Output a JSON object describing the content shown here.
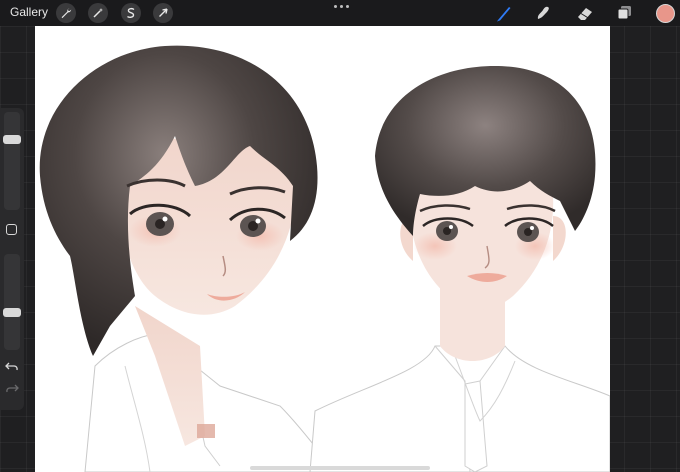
{
  "toolbar": {
    "gallery_label": "Gallery",
    "left_tools": [
      {
        "name": "actions",
        "icon": "wrench-icon"
      },
      {
        "name": "adjustments",
        "icon": "magic-wand-icon"
      },
      {
        "name": "selection",
        "icon": "selection-s-icon"
      },
      {
        "name": "transform",
        "icon": "arrow-cursor-icon"
      }
    ],
    "right_tools": [
      {
        "name": "brush",
        "icon": "brush-icon",
        "active": true
      },
      {
        "name": "smudge",
        "icon": "smudge-icon"
      },
      {
        "name": "eraser",
        "icon": "eraser-icon"
      },
      {
        "name": "layers",
        "icon": "layers-icon"
      }
    ],
    "current_color": "#e8968a"
  },
  "sidebar": {
    "brush_size_level": 0.74,
    "opacity_level": 0.38
  },
  "colors": {
    "toolbar_bg": "#1a1a1c",
    "active_tool": "#2f7bf6",
    "canvas_bg": "#ffffff",
    "hair": "#4a4240",
    "skin": "#f6e4dc"
  }
}
